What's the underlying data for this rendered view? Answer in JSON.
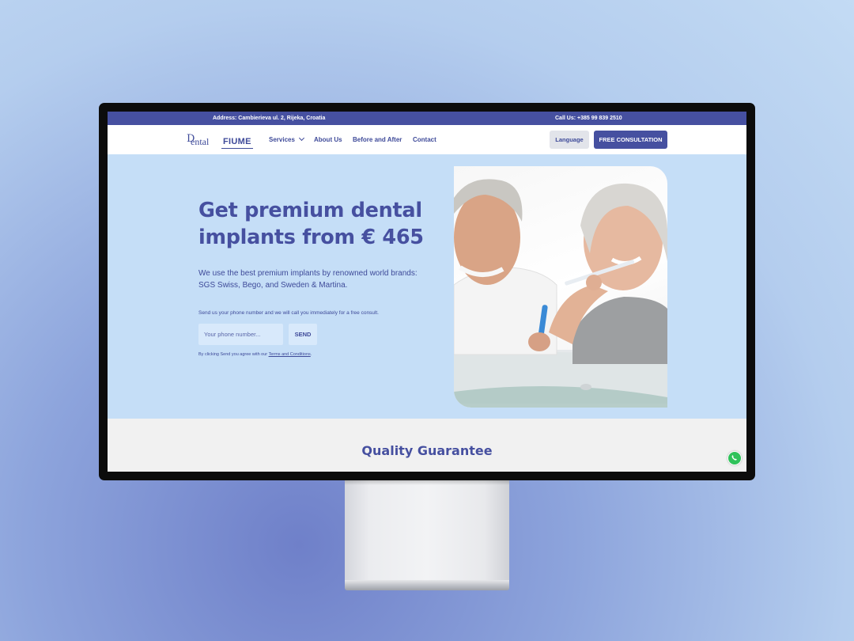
{
  "topbar": {
    "address": "Address: Cambierieva ul. 2, Rijeka, Croatia",
    "phone": "Call Us: +385 99 839 2510"
  },
  "logo": {
    "mark": "D",
    "brand_a": "ental",
    "brand_b": "FIUME"
  },
  "nav": {
    "items": [
      {
        "label": "Services"
      },
      {
        "label": "About Us"
      },
      {
        "label": "Before and After"
      },
      {
        "label": "Contact"
      }
    ],
    "language_label": "Language",
    "consultation_label": "FREE CONSULTATION"
  },
  "hero": {
    "title": "Get premium dental implants from € 465",
    "subtitle": "We use the best premium implants by renowned world brands: SGS Swiss, Bego, and Sweden & Martina.",
    "callback_note": "Send us your phone number and we will call you immediately for a free consult.",
    "phone_placeholder": "Your phone number...",
    "send_label": "SEND",
    "legal_prefix": "By clicking Send you agree with our ",
    "legal_link": "Terms and Conditions",
    "legal_suffix": "."
  },
  "quality": {
    "heading": "Quality Guarantee"
  },
  "colors": {
    "brand": "#4650a0",
    "hero_bg": "#c5def7",
    "whatsapp": "#2fc25a"
  },
  "icons": [
    "chevron-down-icon",
    "whatsapp-icon"
  ]
}
